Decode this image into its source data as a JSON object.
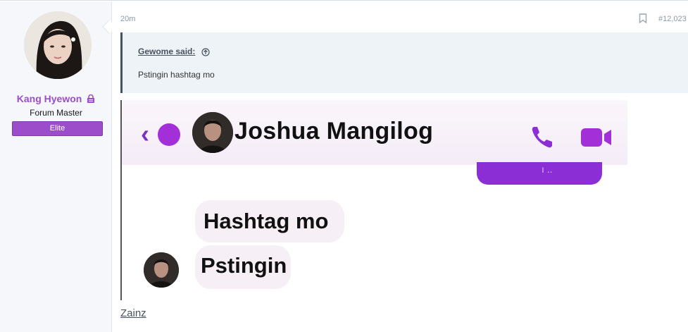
{
  "user": {
    "name": "Kang Hyewon",
    "title": "Forum Master",
    "banner": "Elite"
  },
  "post": {
    "time": "20m",
    "number": "#12,023",
    "quote": {
      "author": "Gewome said:",
      "text": "Pstingin hashtag mo"
    },
    "image": {
      "contact_name": "Joshua Mangilog",
      "messages": [
        "Hashtag mo",
        "Pstingin"
      ],
      "partial_text": "ı ..",
      "icons": [
        "back-chevron-icon",
        "contact-avatar-icon",
        "phone-icon",
        "video-camera-icon"
      ]
    },
    "signature": "Zainz"
  },
  "colors": {
    "username": "#9b4dca",
    "banner": "#9b4dca",
    "quote_bg": "#eef3f8",
    "messenger_purple": "#8b2ed6"
  }
}
